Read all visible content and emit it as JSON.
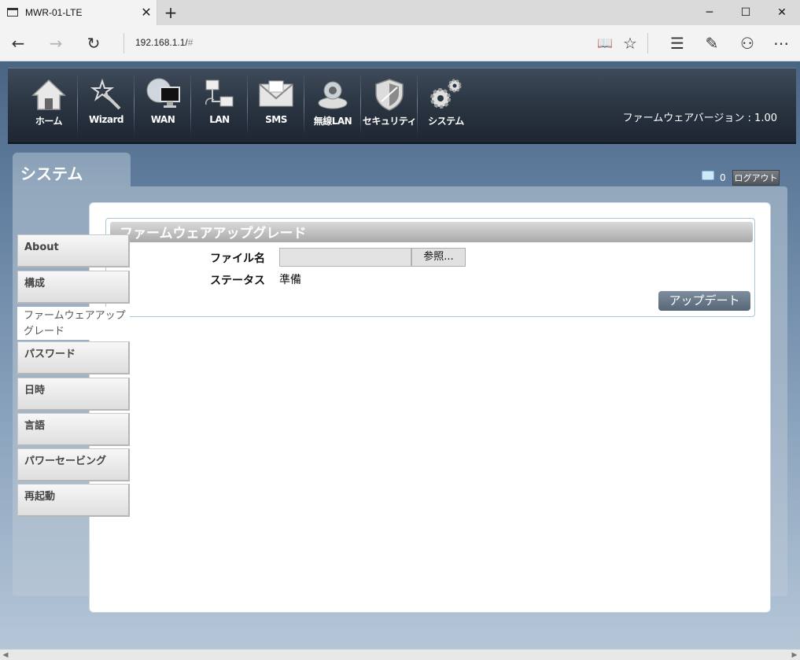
{
  "browser": {
    "tab_title": "MWR-01-LTE",
    "close_glyph": "✕",
    "new_tab_glyph": "+",
    "url_main": "192.168.1.1/",
    "url_hash": "#",
    "win_min": "─",
    "win_max": "☐",
    "win_close": "✕",
    "back": "←",
    "forward": "→",
    "refresh": "↻",
    "reading_view": "📖",
    "favorite": "☆",
    "hub": "☰",
    "note": "✎",
    "share": "⚇",
    "more": "⋯"
  },
  "topbar": {
    "items": [
      {
        "label": "ホーム",
        "icon": "home-icon"
      },
      {
        "label": "Wizard",
        "icon": "wand-icon"
      },
      {
        "label": "WAN",
        "icon": "globe-monitor-icon"
      },
      {
        "label": "LAN",
        "icon": "network-icon"
      },
      {
        "label": "SMS",
        "icon": "envelope-icon"
      },
      {
        "label": "無線LAN",
        "icon": "wireless-icon"
      },
      {
        "label": "セキュリティ",
        "icon": "shield-icon"
      },
      {
        "label": "システム",
        "icon": "gears-icon"
      }
    ],
    "firmware_version": "ファームウェアバージョン : 1.00"
  },
  "header": {
    "section_title": "システム",
    "message_count": "0",
    "logout_label": "ログアウト"
  },
  "sidebar": {
    "items": [
      {
        "label": "About"
      },
      {
        "label": "構成"
      },
      {
        "label": "ファームウェアアップグレード"
      },
      {
        "label": "パスワード"
      },
      {
        "label": "日時"
      },
      {
        "label": "言語"
      },
      {
        "label": "パワーセービング"
      },
      {
        "label": "再起動"
      }
    ]
  },
  "main": {
    "panel_title": "ファームウェアアップグレード",
    "file_label": "ファイル名",
    "file_value": "",
    "browse_label": "参照...",
    "status_label": "ステータス",
    "status_value": "準備",
    "update_button": "アップデート"
  },
  "colors": {
    "topbar_bg": "#2c3744",
    "page_bg": "#5e7b9c",
    "button_bg": "#6a7a8a"
  }
}
